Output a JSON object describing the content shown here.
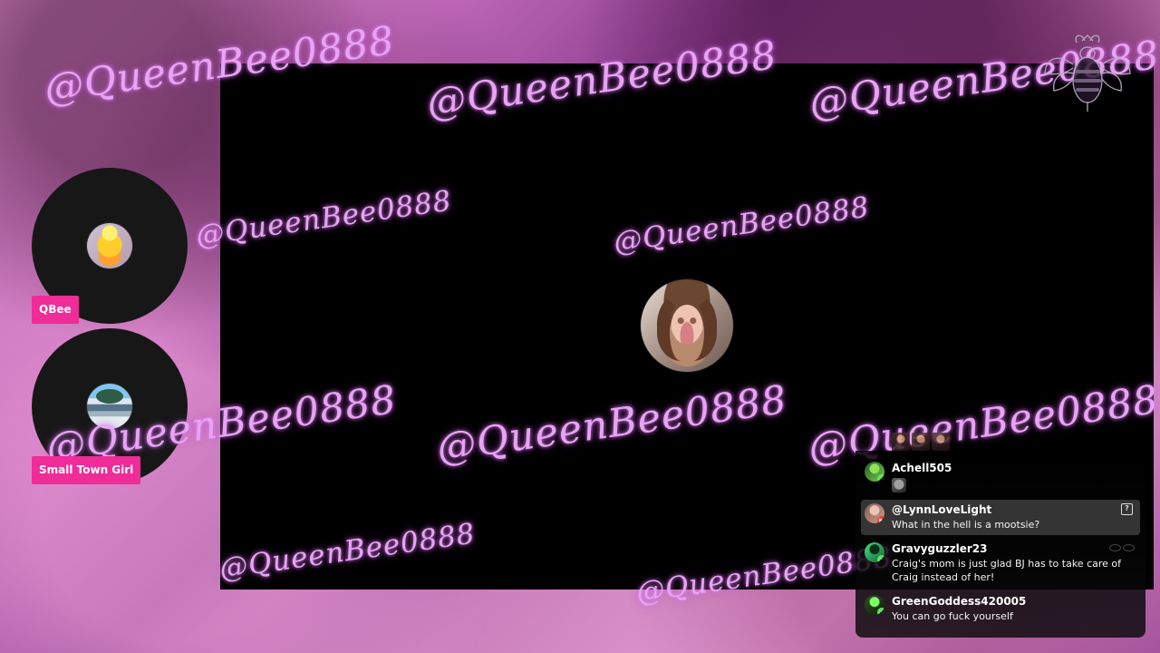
{
  "watermark_text": "@QueenBee0888",
  "speakers": [
    {
      "name": "QBee"
    },
    {
      "name": "Small Town Girl"
    }
  ],
  "chat": {
    "messages": [
      {
        "user": "Achell505",
        "message": "",
        "badge": "verified",
        "avatar_color": "#74c949"
      },
      {
        "user": "@LynnLoveLight",
        "message": "What in the hell is a mootsie?",
        "badge": "youtube",
        "avatar_color": "#bf8e7c"
      },
      {
        "user": "Gravyguzzler23",
        "message": "Craig's mom is just glad BJ has to take care of Craig instead of her!",
        "badge": "verified",
        "avatar_color": "#2cc064"
      },
      {
        "user": "GreenGoddess420005",
        "message": "You can go fuck yourself",
        "badge": "verified",
        "avatar_color": "#4a7b31"
      }
    ]
  },
  "colors": {
    "name_tag": "#ef2c97",
    "watermark": "#e7a4f3",
    "video_bg": "#000000",
    "chat_bg": "#000000",
    "chat_highlight": "#343434"
  },
  "icons": {
    "logo": "bee-logo-icon",
    "chat_menu": "report-icon",
    "reaction": "reaction-thumbnail-icon"
  }
}
